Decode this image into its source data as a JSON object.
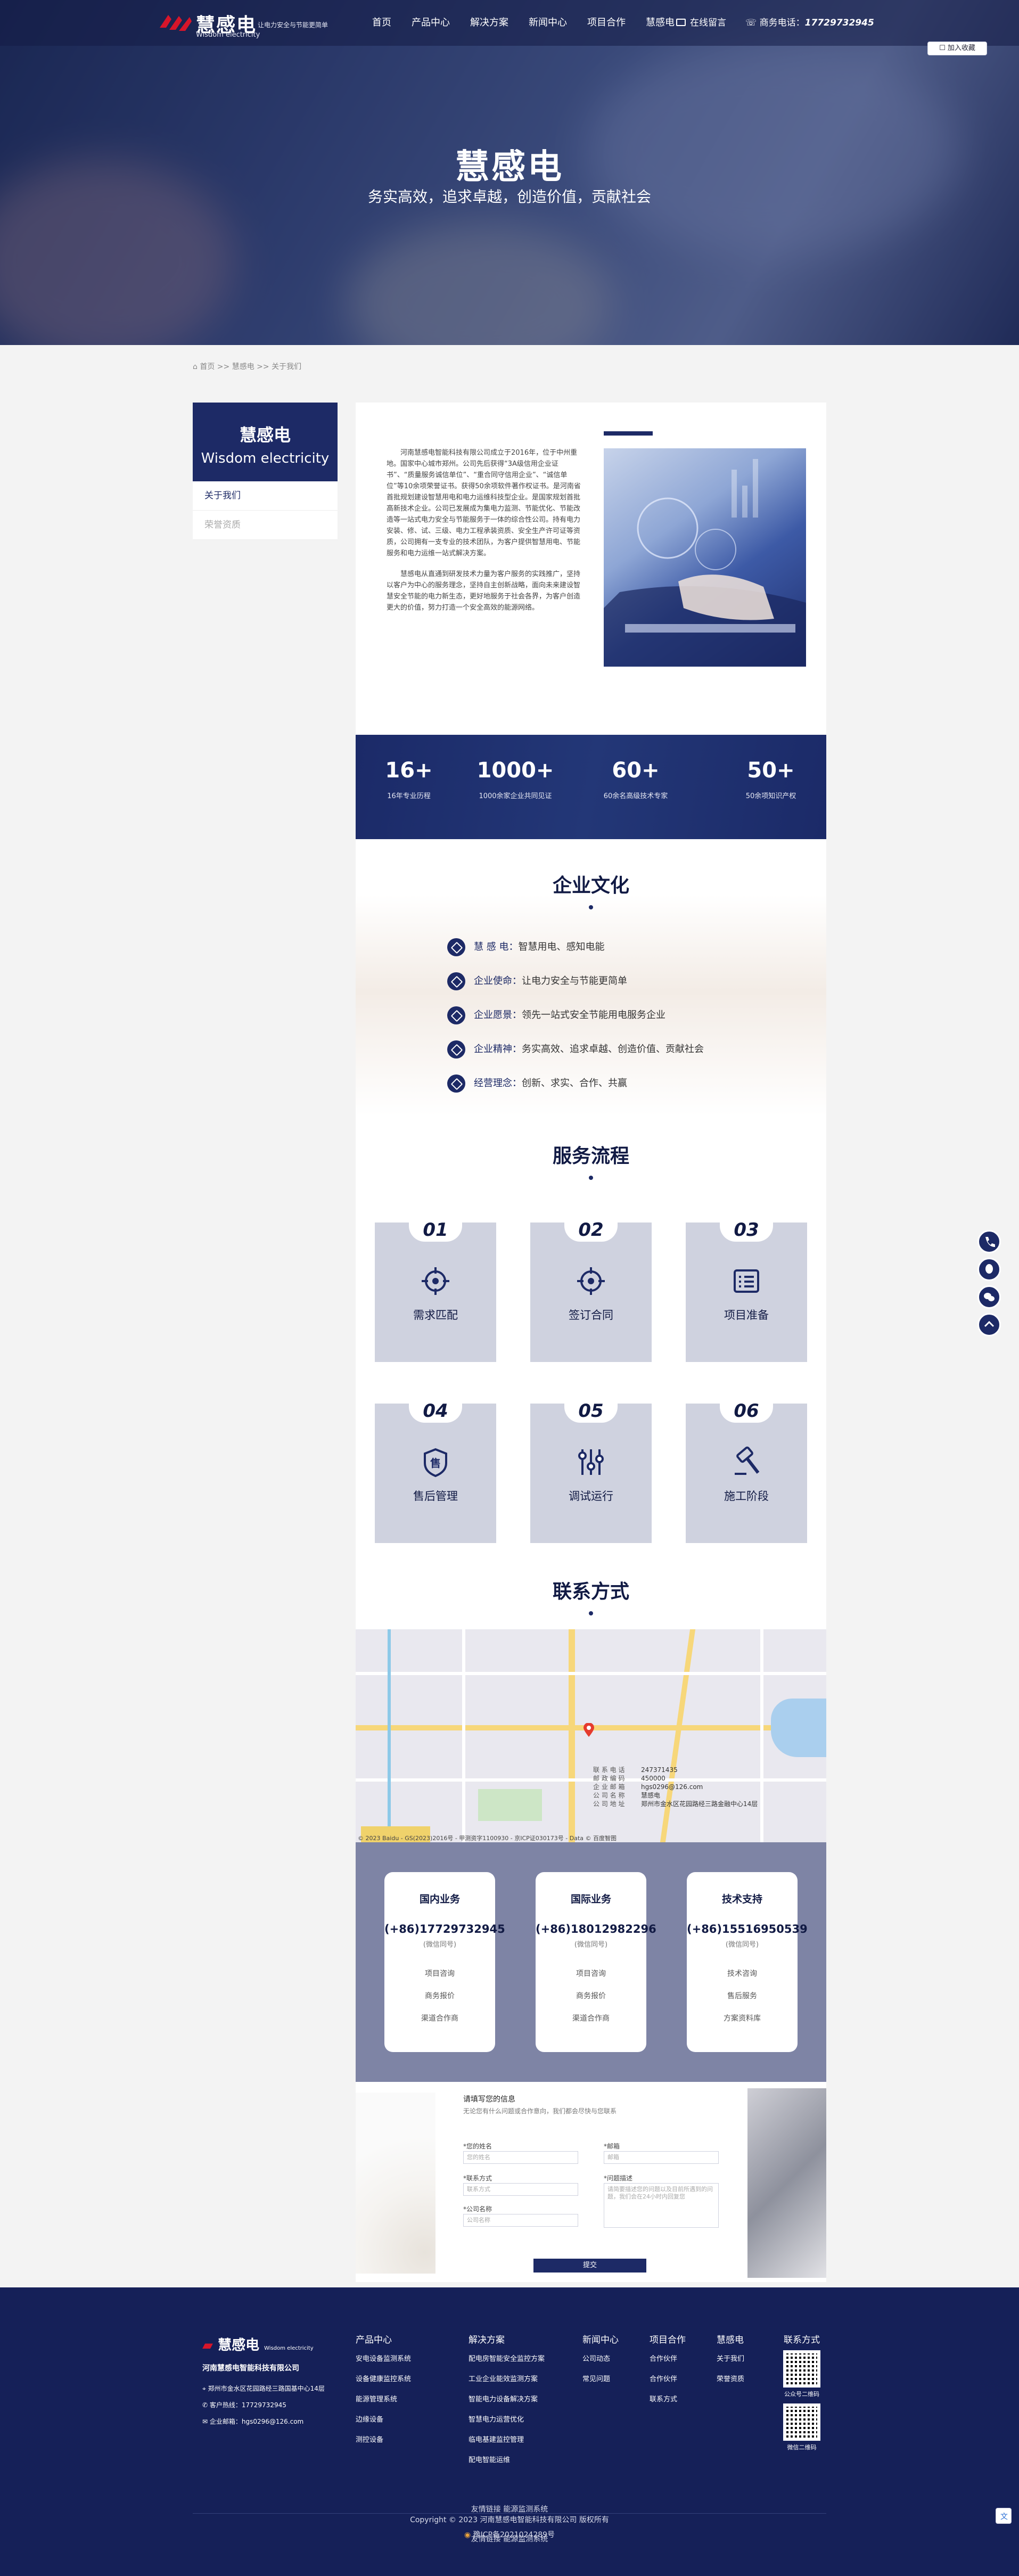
{
  "brand": {
    "name_cn": "慧感电",
    "name_en": "Wisdom electricity",
    "slogan": "让电力安全与节能更简单",
    "color": "#1d2a66",
    "accent": "#d7152a"
  },
  "nav": [
    "首页",
    "产品中心",
    "解决方案",
    "新闻中心",
    "项目合作",
    "慧感电"
  ],
  "topbar": {
    "mail": "在线留言",
    "phone_label": "商务电话：",
    "phone": "17729732945",
    "fav": "☐ 加入收藏"
  },
  "hero": {
    "title": "慧感电",
    "subtitle": "务实高效，追求卓越，创造价值，贡献社会"
  },
  "breadcrumb": "首页 >> 慧感电 >> 关于我们",
  "side": {
    "title_cn": "慧感电",
    "title_en": "Wisdom electricity",
    "items": [
      "关于我们",
      "荣誉资质"
    ]
  },
  "about": {
    "p1": "河南慧感电智能科技有限公司成立于2016年，位于中州重地。国家中心城市郑州。公司先后获得“3A级信用企业证书”、“质量服务诚信单位”、“重合同守信用企业”、“诚信单位”等10余项荣誉证书。获得50余项软件著作权证书。是河南省首批规划建设智慧用电和电力运维科技型企业。是国家规划首批高新技术企业。公司已发展成为集电力监测、节能优化、节能改造等一站式电力安全与节能服务于一体的综合性公司。持有电力安装、修、试、三级、电力工程承装资质、安全生产许可证等资质，公司拥有一支专业的技术团队，为客户提供智慧用电、节能服务和电力运维一站式解决方案。",
    "p2": "慧感电从直通到研发技术力量为客户服务的实践推广，坚持以客户为中心的服务理念，坚持自主创新战略，面向未来建设智慧安全节能的电力新生态，更好地服务于社会各界，为客户创造更大的价值，努力打造一个安全高效的能源网络。"
  },
  "stats": [
    {
      "value": "16+",
      "label": "16年专业历程"
    },
    {
      "value": "1000+",
      "label": "1000余家企业共同见证"
    },
    {
      "value": "60+",
      "label": "60余名高级技术专家"
    },
    {
      "value": "50+",
      "label": "50余项知识产权"
    }
  ],
  "culture": {
    "title": "企业文化",
    "items": [
      {
        "key": "慧 感 电：",
        "val": "智慧用电、感知电能"
      },
      {
        "key": "企业使命：",
        "val": "让电力安全与节能更简单"
      },
      {
        "key": "企业愿景：",
        "val": "领先一站式安全节能用电服务企业"
      },
      {
        "key": "企业精神：",
        "val": "务实高效、追求卓越、创造价值、贡献社会"
      },
      {
        "key": "经营理念：",
        "val": "创新、求实、合作、共赢"
      }
    ]
  },
  "process": {
    "title": "服务流程",
    "steps": [
      {
        "num": "01",
        "label": "需求匹配",
        "icon": "target-icon"
      },
      {
        "num": "02",
        "label": "签订合同",
        "icon": "crosshair-icon"
      },
      {
        "num": "03",
        "label": "项目准备",
        "icon": "list-icon"
      },
      {
        "num": "04",
        "label": "售后管理",
        "icon": "shield-sale-icon"
      },
      {
        "num": "05",
        "label": "调试运行",
        "icon": "sliders-icon"
      },
      {
        "num": "06",
        "label": "施工阶段",
        "icon": "hammer-icon"
      }
    ]
  },
  "contact": {
    "title": "联系方式",
    "info": [
      {
        "k": "联 系 电 话",
        "v": "247371435"
      },
      {
        "k": "邮 政 编 码",
        "v": "450000"
      },
      {
        "k": "企 业 邮 箱",
        "v": "hgs0296@126.com"
      },
      {
        "k": "公 司 名 称",
        "v": "慧感电"
      },
      {
        "k": "公 司 地 址",
        "v": "郑州市金水区花园路经三路金融中心14层"
      }
    ],
    "map_copy": "© 2023 Baidu - GS(2023)2016号 - 甲测资字1100930 - 京ICP证030173号 - Data © 百度智图"
  },
  "services": [
    {
      "title": "国内业务",
      "phone": "(+86)17729732945",
      "sub": "(微信同号)",
      "links": [
        "项目咨询",
        "商务报价",
        "渠道合作商"
      ]
    },
    {
      "title": "国际业务",
      "phone": "(+86)18012982296",
      "sub": "(微信同号)",
      "links": [
        "项目咨询",
        "商务报价",
        "渠道合作商"
      ]
    },
    {
      "title": "技术支持",
      "phone": "(+86)15516950539",
      "sub": "(微信同号)",
      "links": [
        "技术咨询",
        "售后服务",
        "方案资料库"
      ]
    }
  ],
  "form": {
    "title": "请填写您的信息",
    "subtitle": "无论您有什么问题或合作意向，我们都会尽快与您联系",
    "fields": [
      {
        "label": "*您的姓名",
        "placeholder": "您的姓名"
      },
      {
        "label": "*邮箱",
        "placeholder": "邮箱"
      },
      {
        "label": "*联系方式",
        "placeholder": "联系方式"
      },
      {
        "label": "*问题描述",
        "placeholder": "请简要描述您的问题以及目前所遇到的问题，我们会在24小时内回复您"
      },
      {
        "label": "*公司名称",
        "placeholder": "公司名称"
      }
    ],
    "submit": "提交"
  },
  "footer": {
    "company": "河南慧感电智能科技有限公司",
    "address": "郑州市金水区花园路经三路国基中心14层",
    "phone": "客户热线：17729732945",
    "email": "企业邮箱：hgs0296@126.com",
    "cols": [
      {
        "title": "产品中心",
        "items": [
          "安电设备监测系统",
          "设备健康监控系统",
          "能源管理系统",
          "边缘设备",
          "测控设备"
        ]
      },
      {
        "title": "解决方案",
        "items": [
          "配电房智能安全监控方案",
          "工业企业能效监测方案",
          "智能电力设备解决方案",
          "智慧电力运营优化",
          "临电基建监控管理",
          "配电智能运维"
        ]
      },
      {
        "title": "新闻中心",
        "items": [
          "公司动态",
          "常见问题"
        ]
      },
      {
        "title": "项目合作",
        "items": [
          "合作伙伴",
          "合作伙伴",
          "联系方式"
        ]
      },
      {
        "title": "慧感电",
        "items": [
          "关于我们",
          "荣誉资质"
        ]
      }
    ],
    "contact_title": "联系方式",
    "qr1": "公众号二维码",
    "qr2": "微信二维码",
    "links": "友情链接    能源监测系统",
    "copyright": "Copyright © 2023 河南慧感电智能科技有限公司 版权所有",
    "icp": "豫ICP备2021024289号"
  }
}
